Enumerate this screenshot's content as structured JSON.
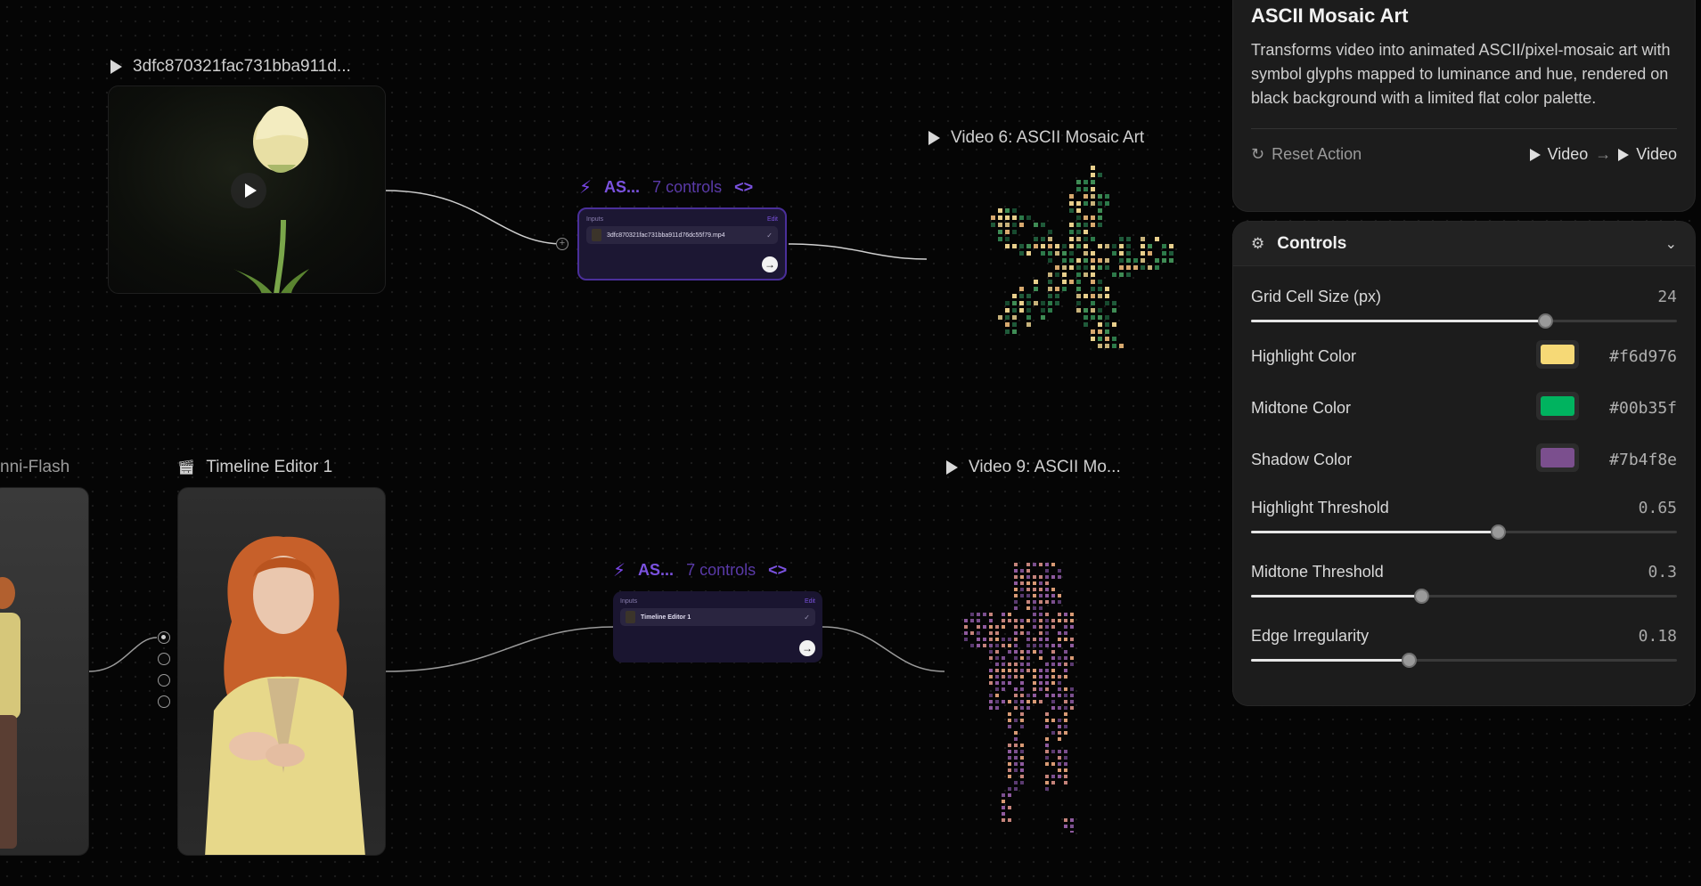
{
  "nodes": {
    "source_video_1": {
      "title": "3dfc870321fac731bba911d..."
    },
    "output_video_6": {
      "title": "Video 6: ASCII Mosaic Art"
    },
    "output_video_9": {
      "title": "Video 9: ASCII Mo..."
    },
    "omni_flash": {
      "title": "nni-Flash"
    },
    "timeline_editor": {
      "title": "Timeline Editor 1"
    }
  },
  "actions": [
    {
      "name": "AS...",
      "controls": "7 controls",
      "code_glyph": "<>",
      "inputs_label": "Inputs",
      "edit_label": "Edit",
      "input_file": "3dfc870321fac731bba911d76dc55f79.mp4"
    },
    {
      "name": "AS...",
      "controls": "7 controls",
      "code_glyph": "<>",
      "inputs_label": "Inputs",
      "edit_label": "Edit",
      "input_file": "Timeline Editor 1"
    }
  ],
  "info_panel": {
    "title": "ASCII Mosaic Art",
    "description": "Transforms video into animated ASCII/pixel-mosaic art with symbol glyphs mapped to luminance and hue, rendered on black background with a limited flat color palette.",
    "reset_label": "Reset Action",
    "input_type": "Video",
    "output_type": "Video",
    "arrow": "→"
  },
  "controls": {
    "header": "Controls",
    "items": {
      "grid_cell_size": {
        "label": "Grid Cell Size (px)",
        "value": "24",
        "level": 0.69
      },
      "highlight_color": {
        "label": "Highlight Color",
        "value": "#f6d976",
        "color": "#f6d976"
      },
      "midtone_color": {
        "label": "Midtone Color",
        "value": "#00b35f",
        "color": "#00b35f"
      },
      "shadow_color": {
        "label": "Shadow Color",
        "value": "#7b4f8e",
        "color": "#7b4f8e"
      },
      "highlight_threshold": {
        "label": "Highlight Threshold",
        "value": "0.65",
        "level": 0.58
      },
      "midtone_threshold": {
        "label": "Midtone Threshold",
        "value": "0.3",
        "level": 0.4
      },
      "edge_irregularity": {
        "label": "Edge Irregularity",
        "value": "0.18",
        "level": 0.37
      }
    }
  },
  "icons": {
    "play": "play-icon",
    "bolt": "bolt-icon",
    "code": "code-icon",
    "reset": "reset-icon",
    "sliders": "sliders-icon",
    "chevron": "chevron-down-icon",
    "clapper": "clapperboard-icon"
  }
}
